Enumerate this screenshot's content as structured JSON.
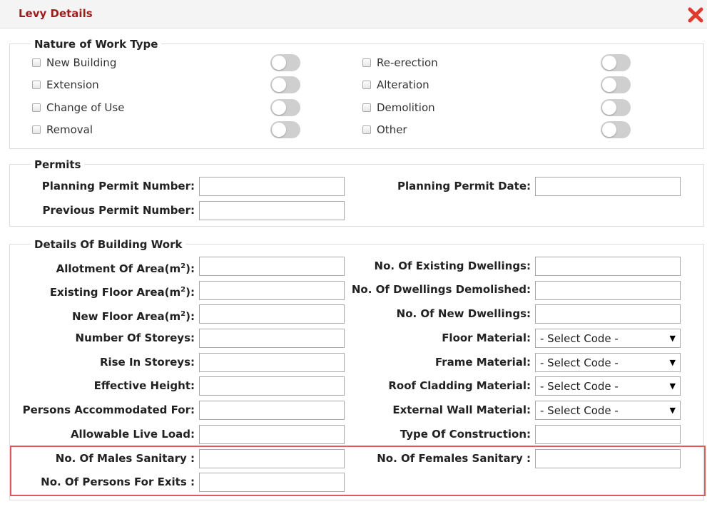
{
  "dialog": {
    "title": "Levy Details",
    "close_icon": "close-icon",
    "close_color": "#e03a2f"
  },
  "nature": {
    "legend": "Nature of Work Type",
    "left": [
      "New Building",
      "Extension",
      "Change of Use",
      "Removal"
    ],
    "right": [
      "Re-erection",
      "Alteration",
      "Demolition",
      "Other"
    ]
  },
  "permits": {
    "legend": "Permits",
    "planning_permit_number": {
      "label": "Planning Permit Number:",
      "value": ""
    },
    "previous_permit_number": {
      "label": "Previous Permit Number:",
      "value": ""
    },
    "planning_permit_date": {
      "label": "Planning Permit Date:",
      "value": ""
    }
  },
  "details": {
    "legend": "Details Of Building Work",
    "left": [
      {
        "label": "Allotment Of Area(m",
        "sup": "2",
        "suffix": "):",
        "value": ""
      },
      {
        "label": "Existing Floor Area(m",
        "sup": "2",
        "suffix": "):",
        "value": ""
      },
      {
        "label": "New Floor Area(m",
        "sup": "2",
        "suffix": "):",
        "value": ""
      },
      {
        "label": "Number Of Storeys:",
        "value": ""
      },
      {
        "label": "Rise In Storeys:",
        "value": ""
      },
      {
        "label": "Effective Height:",
        "value": ""
      },
      {
        "label": "Persons Accommodated For:",
        "value": ""
      },
      {
        "label": "Allowable Live Load:",
        "value": ""
      },
      {
        "label": "No. Of Males Sanitary :",
        "value": ""
      },
      {
        "label": "No. Of Persons For Exits :",
        "value": ""
      }
    ],
    "right": [
      {
        "label": "No. Of Existing Dwellings:",
        "value": ""
      },
      {
        "label": "No. Of Dwellings Demolished:",
        "value": ""
      },
      {
        "label": "No. Of New Dwellings:",
        "value": ""
      },
      {
        "label": "Floor Material:",
        "select": "- Select Code -"
      },
      {
        "label": "Frame Material:",
        "select": "- Select Code -"
      },
      {
        "label": "Roof Cladding Material:",
        "select": "- Select Code -"
      },
      {
        "label": "External Wall Material:",
        "select": "- Select Code -"
      },
      {
        "label": "Type Of Construction:",
        "value": ""
      },
      {
        "label": "No. Of Females Sanitary :",
        "value": ""
      }
    ]
  },
  "colors": {
    "title": "#9b1c1c",
    "highlight_border": "#e05a57"
  }
}
